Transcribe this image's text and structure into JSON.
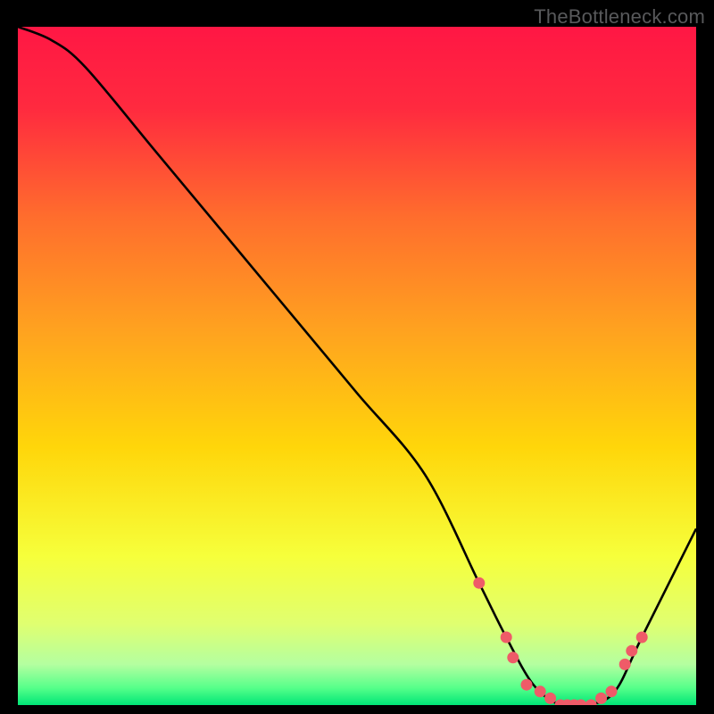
{
  "watermark": "TheBottleneck.com",
  "chart_data": {
    "type": "line",
    "title": "",
    "xlabel": "",
    "ylabel": "",
    "xlim": [
      0,
      100
    ],
    "ylim": [
      0,
      100
    ],
    "gradient_background": true,
    "main_curve": {
      "name": "bottleneck-curve",
      "x": [
        0,
        5,
        10,
        20,
        30,
        40,
        50,
        60,
        68,
        72,
        76,
        80,
        84,
        88,
        92,
        100
      ],
      "y": [
        100,
        98,
        94,
        82,
        70,
        58,
        46,
        34,
        18,
        10,
        3,
        0,
        0,
        2,
        10,
        26
      ]
    },
    "markers": {
      "name": "highlighted-points",
      "x": [
        68,
        72,
        73,
        75,
        77,
        78.5,
        80,
        81,
        82,
        83,
        84.5,
        86,
        87.5,
        89.5,
        90.5,
        92
      ],
      "y": [
        18,
        10,
        7,
        3,
        2,
        1,
        0,
        0,
        0,
        0,
        0,
        1,
        2,
        6,
        8,
        10
      ]
    },
    "gradient_stops": [
      {
        "offset": 0.0,
        "color": "#ff1744"
      },
      {
        "offset": 0.12,
        "color": "#ff2a3f"
      },
      {
        "offset": 0.28,
        "color": "#ff6d2d"
      },
      {
        "offset": 0.45,
        "color": "#ffa31f"
      },
      {
        "offset": 0.62,
        "color": "#ffd60a"
      },
      {
        "offset": 0.78,
        "color": "#f6ff3b"
      },
      {
        "offset": 0.88,
        "color": "#e0ff70"
      },
      {
        "offset": 0.94,
        "color": "#b4ffa0"
      },
      {
        "offset": 0.975,
        "color": "#55ff8a"
      },
      {
        "offset": 1.0,
        "color": "#00e676"
      }
    ],
    "colors": {
      "curve": "#000000",
      "marker_fill": "#ef5b68",
      "marker_stroke": "#ef5b68"
    }
  }
}
